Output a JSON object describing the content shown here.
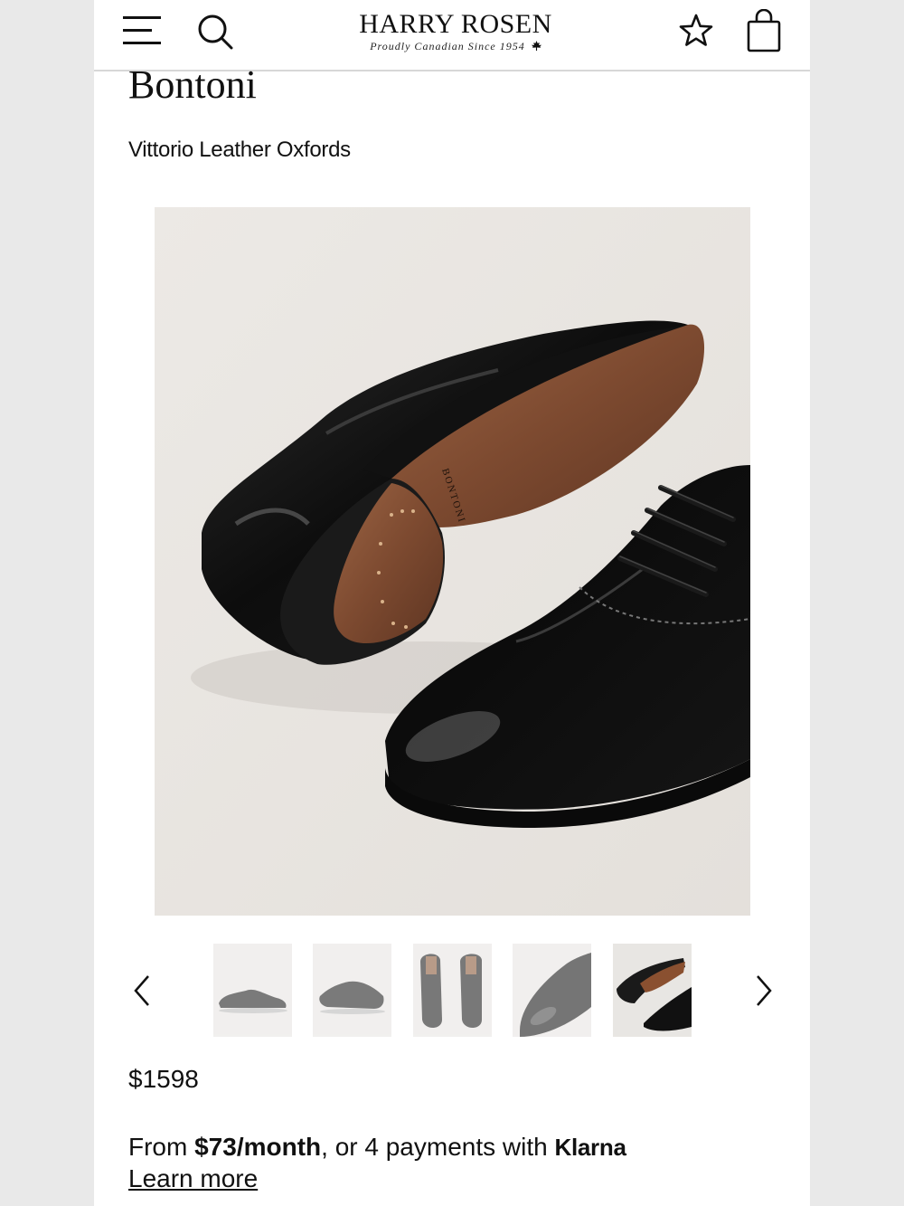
{
  "header": {
    "logo_main": "HARRY ROSEN",
    "logo_tagline": "Proudly Canadian Since 1954",
    "icons": [
      "menu-icon",
      "search-icon",
      "star-icon",
      "shopping-bag-icon",
      "maple-leaf-icon"
    ]
  },
  "product": {
    "brand": "Bontoni",
    "name": "Vittorio Leather Oxfords",
    "sole_stamp": "BONTONI",
    "price": "$1598"
  },
  "gallery": {
    "thumbnails": 5,
    "selected_index": 4,
    "icons": [
      "chevron-left-icon",
      "chevron-right-icon"
    ]
  },
  "financing": {
    "prefix": "From",
    "amount": "$73/month",
    "middle": ", or 4 payments with",
    "provider": "Klarna",
    "link": "Learn more"
  },
  "colors": {
    "background": "#ffffff",
    "image_bg": "#e9e6e2",
    "text": "#111111",
    "divider": "#d7d7d7"
  }
}
